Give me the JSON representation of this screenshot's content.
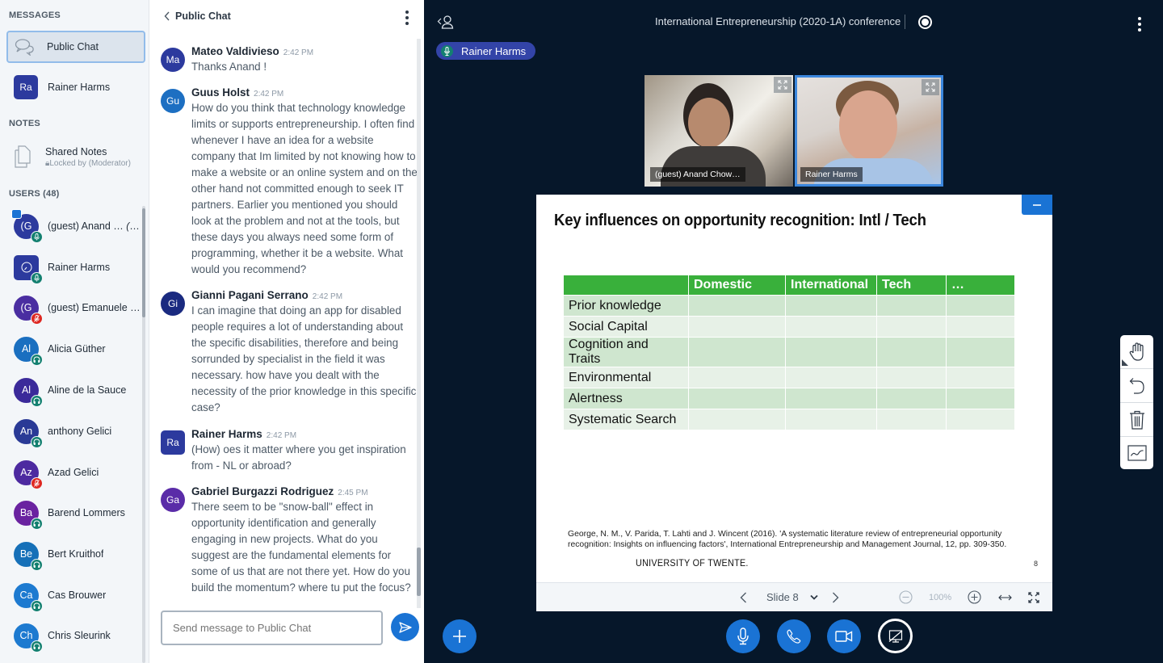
{
  "userlist": {
    "messages_title": "MESSAGES",
    "messages": [
      {
        "label": "Public Chat",
        "icon": "chat-bubbles-icon",
        "active": true
      },
      {
        "label": "Rainer Harms",
        "initials": "Ra"
      }
    ],
    "notes_title": "NOTES",
    "notes": {
      "label": "Shared Notes",
      "sub": "Locked by (Moderator)",
      "lock_icon": "lock-icon"
    },
    "users_title": "USERS (48)",
    "users": [
      {
        "initials": "(G",
        "name": "(guest) Anand …",
        "you": "(You)",
        "color": "#2c3a9e",
        "status": "mic",
        "presenter": true
      },
      {
        "initials": "",
        "name": "Rainer Harms",
        "color": "#2c3a9e",
        "status": "mic",
        "moderator": true
      },
      {
        "initials": "(G",
        "name": "(guest) Emanuele S…",
        "color": "#4a2ea1",
        "status": "muted"
      },
      {
        "initials": "Al",
        "name": "Alicia Güther",
        "color": "#1a6fc0",
        "status": "listen"
      },
      {
        "initials": "Al",
        "name": "Aline de la Sauce",
        "color": "#3b2a9a",
        "status": "listen"
      },
      {
        "initials": "An",
        "name": "anthony Gelici",
        "color": "#2a3a96",
        "status": "listen"
      },
      {
        "initials": "Az",
        "name": "Azad Gelici",
        "color": "#4d2aa0",
        "status": "muted"
      },
      {
        "initials": "Ba",
        "name": "Barend Lommers",
        "color": "#6a23a0",
        "status": "listen"
      },
      {
        "initials": "Be",
        "name": "Bert Kruithof",
        "color": "#1670b8",
        "status": "listen"
      },
      {
        "initials": "Ca",
        "name": "Cas Brouwer",
        "color": "#1d7ad0",
        "status": "listen"
      },
      {
        "initials": "Ch",
        "name": "Chris Sleurink",
        "color": "#1d7ad0",
        "status": "listen"
      }
    ]
  },
  "chat": {
    "title": "Public Chat",
    "messages": [
      {
        "initials": "Ma",
        "name": "Mateo Valdivieso",
        "time": "2:42 PM",
        "text": "Thanks Anand !",
        "color": "#2c3a9e"
      },
      {
        "initials": "Gu",
        "name": "Guus Holst",
        "time": "2:42 PM",
        "text": "How do you think that technology knowledge limits or supports entrepreneurship. I often find whenever I have an idea for a website company that Im limited by not knowing how to make a website or an online system and on the other hand not committed enough to seek IT partners. Earlier you mentioned you should look at the problem and not at the tools, but these days you always need some form of programming, whether it be a website. What would you recommend?",
        "color": "#1d6fc2"
      },
      {
        "initials": "Gi",
        "name": "Gianni Pagani Serrano",
        "time": "2:42 PM",
        "text": "I can imagine that doing an app for disabled people requires a lot of understanding about the specific disabilities, therefore and being sorrunded by specialist in the field it was necessary. how have you dealt with the necessity of the prior knowledge in this specific case?",
        "color": "#1a2a80"
      },
      {
        "initials": "Ra",
        "name": "Rainer Harms",
        "time": "2:42 PM",
        "text": "(How) oes it matter where you get inspiration from - NL or abroad?",
        "color": "#2c3a9e"
      },
      {
        "initials": "Ga",
        "name": "Gabriel Burgazzi Rodriguez",
        "time": "2:45 PM",
        "text": "There seem to be \"snow-ball\" effect in opportunity identification and generally engaging in new projects. What do you suggest are the fundamental elements for some of us that are not there yet. How do you build the momentum? where tu put the focus?",
        "color": "#5a2ca8"
      }
    ],
    "input_placeholder": "Send message to Public Chat"
  },
  "main": {
    "meeting_title": "International Entrepreneurship (2020-1A) conference",
    "talking_indicator": "Rainer Harms",
    "videos": [
      {
        "name": "(guest) Anand Chow…"
      },
      {
        "name": "Rainer Harms",
        "active_speaker": true
      }
    ],
    "slide": {
      "title": "Key influences on opportunity recognition: Intl / Tech",
      "table": {
        "headers": [
          "",
          "Domestic",
          "International",
          "Tech",
          "…"
        ],
        "rows": [
          "Prior knowledge",
          "Social Capital",
          "Cognition and Traits",
          "Environmental",
          "Alertness",
          "Systematic Search"
        ]
      },
      "citation": "George, N. M., V. Parida, T. Lahti and J. Wincent (2016). 'A systematic literature review of entrepreneurial opportunity recognition: Insights on influencing factors', International Entrepreneurship and Management Journal, 12, pp. 309-350.",
      "institution": "UNIVERSITY OF TWENTE.",
      "page_number": "8"
    },
    "slide_toolbar": {
      "slide_label": "Slide 8",
      "zoom": "100%"
    },
    "whiteboard_tools": [
      "hand-icon",
      "undo-icon",
      "trash-icon",
      "line-chart-icon"
    ],
    "actions": [
      "plus-icon",
      "microphone-icon",
      "phone-icon",
      "video-camera-icon",
      "screen-share-off-icon"
    ],
    "colors": {
      "primary": "#1a73d4",
      "background": "#06172a",
      "success": "#138070",
      "danger": "#de2721"
    }
  }
}
